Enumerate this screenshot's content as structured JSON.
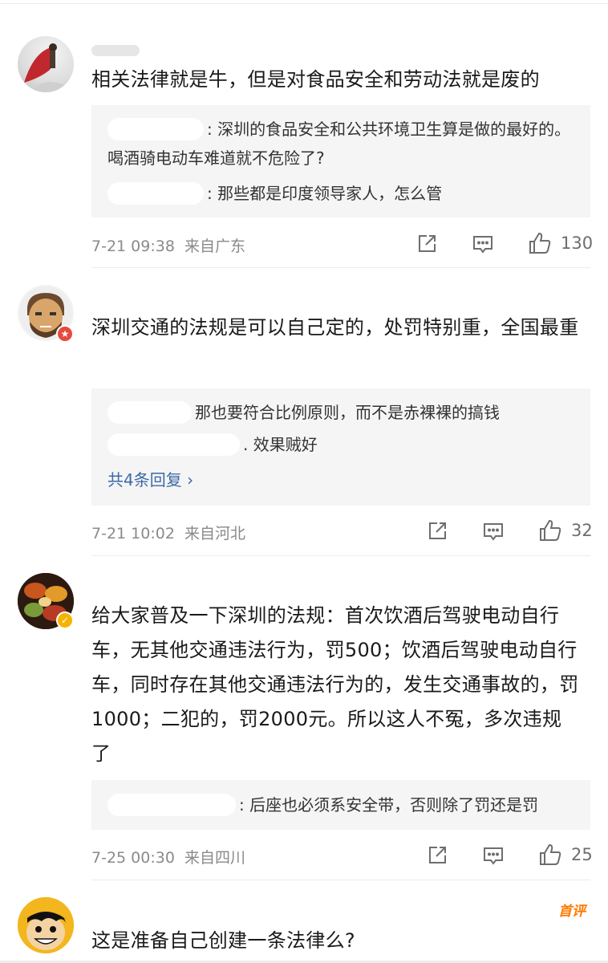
{
  "comments": [
    {
      "text": "相关法律就是牛，但是对食品安全和劳动法就是废的",
      "replies": [
        ": 深圳的食品安全和公共环境卫生算是做的最好的。喝酒骑电动车难道就不危险了?",
        ": 那些都是印度领导家人，怎么管"
      ],
      "date": "7-21 09:38",
      "location": "来自广东",
      "likes": "130"
    },
    {
      "text": "深圳交通的法规是可以自己定的，处罚特别重，全国最重",
      "replies": [
        "那也要符合比例原则，而不是赤裸裸的搞钱",
        ". 效果贼好"
      ],
      "more_replies": "共4条回复 ›",
      "date": "7-21 10:02",
      "location": "来自河北",
      "likes": "32"
    },
    {
      "text": "给大家普及一下深圳的法规：首次饮酒后驾驶电动自行车，无其他交通违法行为，罚500；饮酒后驾驶电动自行车，同时存在其他交通违法行为的，发生交通事故的，罚1000；二犯的，罚2000元。所以这人不冤，多次违规了",
      "replies": [
        ": 后座也必须系安全带，否则除了罚还是罚"
      ],
      "date": "7-25 00:30",
      "location": "来自四川",
      "likes": "25"
    },
    {
      "text": "这是准备自己创建一条法律么?",
      "tag": "首评"
    }
  ],
  "icons": {
    "share": "share-icon",
    "comment": "comment-icon",
    "like": "like-icon"
  },
  "colors": {
    "link": "#3c6aa6",
    "hot_tag": "#ff7a00",
    "reply_bg": "#f5f5f5"
  }
}
